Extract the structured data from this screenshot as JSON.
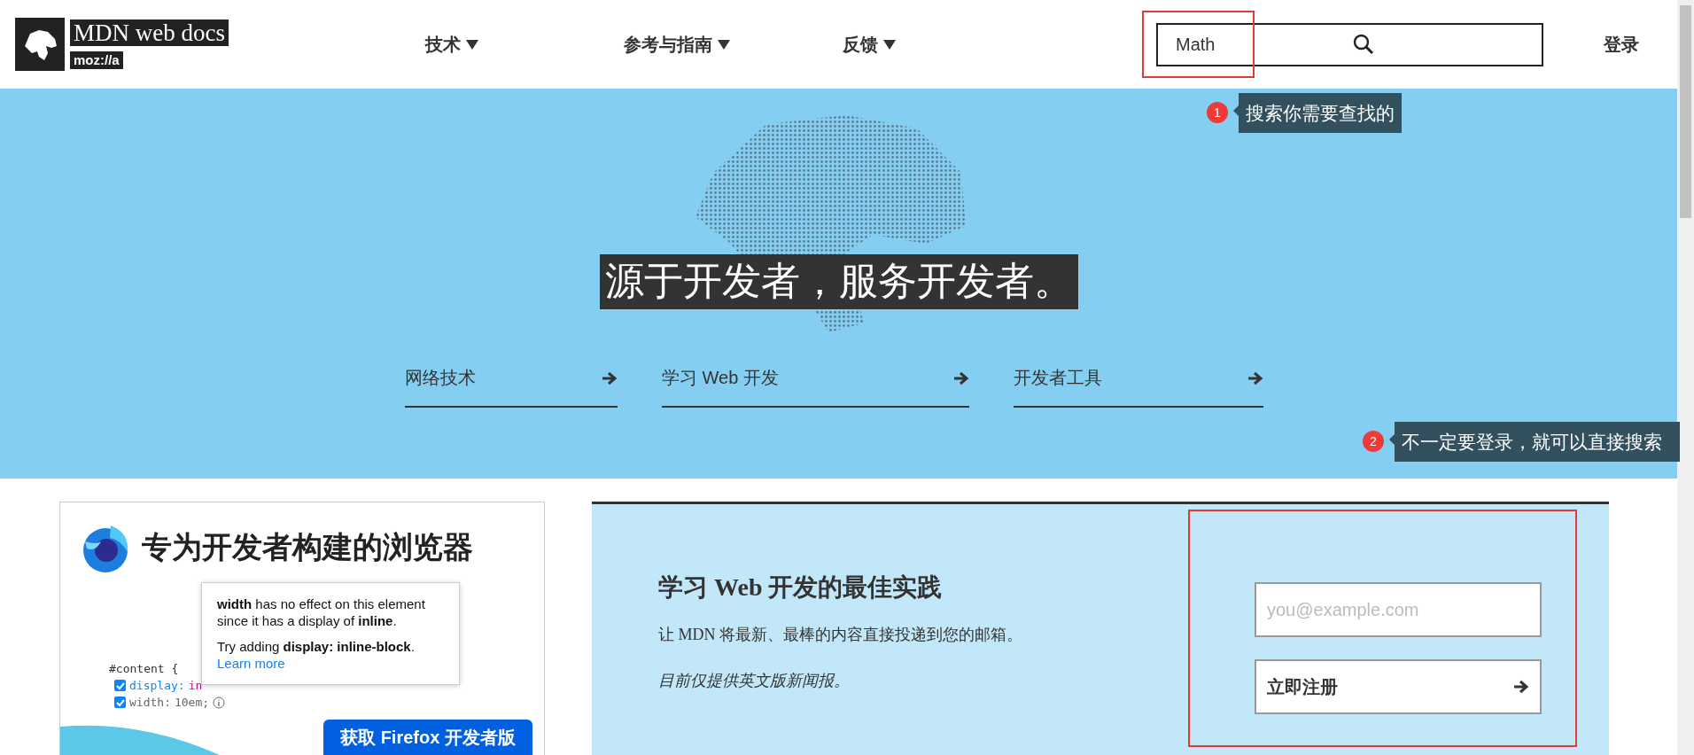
{
  "header": {
    "logo": {
      "title": "MDN web docs",
      "subtitle": "moz://a"
    },
    "nav": [
      {
        "label": "技术"
      },
      {
        "label": "参考与指南"
      },
      {
        "label": "反馈"
      }
    ],
    "search": {
      "value": "Math",
      "highlighted": true
    },
    "login": "登录"
  },
  "hero": {
    "headline": "源于开发者，服务开发者。",
    "links": [
      "网络技术",
      "学习 Web 开发",
      "开发者工具"
    ]
  },
  "annotations": [
    {
      "number": "1",
      "text": "搜索你需要查找的"
    },
    {
      "number": "2",
      "text": "不一定要登录，就可以直接搜索"
    }
  ],
  "promo": {
    "title": "专为开发者构建的浏览器",
    "tooltip": {
      "message": "**width** has no effect on this element since it has a display of **inline**.",
      "hint": "Try adding **display: inline-block**.",
      "link": "Learn more"
    },
    "code": {
      "selector": "#content {",
      "rules": [
        {
          "property": "display:",
          "value": "in",
          "checked": true
        },
        {
          "property": "width:",
          "value": "10em;",
          "checked": true
        }
      ]
    },
    "button": "获取 Firefox 开发者版"
  },
  "newsletter": {
    "title": "学习 Web 开发的最佳实践",
    "description": "让 MDN 将最新、最棒的内容直接投递到您的邮箱。",
    "note": "目前仅提供英文版新闻报。",
    "email": {
      "placeholder": "you@example.com"
    },
    "button": "立即注册",
    "highlighted": true
  }
}
